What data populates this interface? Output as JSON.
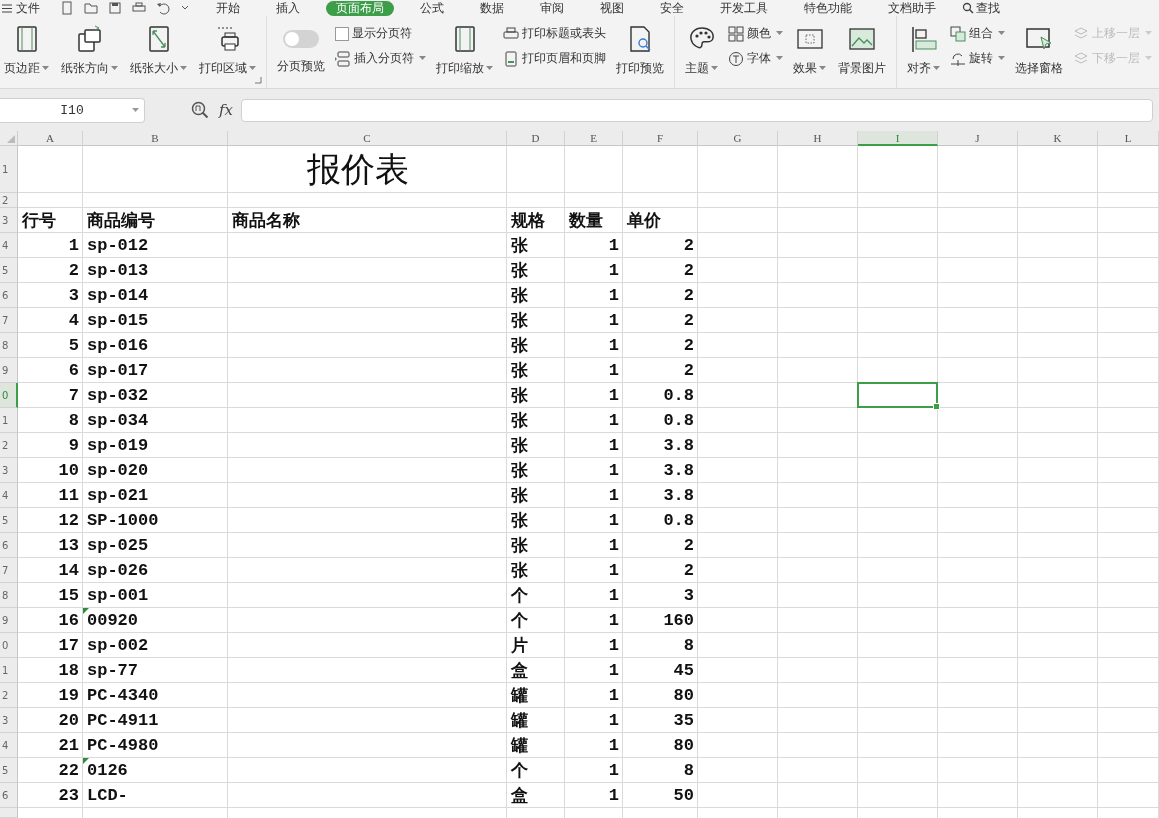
{
  "menu": {
    "file": "文件",
    "tabs": [
      {
        "label": "开始",
        "selected": false
      },
      {
        "label": "插入",
        "selected": false
      },
      {
        "label": "页面布局",
        "selected": true
      },
      {
        "label": "公式",
        "selected": false
      },
      {
        "label": "数据",
        "selected": false
      },
      {
        "label": "审阅",
        "selected": false
      },
      {
        "label": "视图",
        "selected": false
      },
      {
        "label": "安全",
        "selected": false
      },
      {
        "label": "开发工具",
        "selected": false
      },
      {
        "label": "特色功能",
        "selected": false
      },
      {
        "label": "文档助手",
        "selected": false
      }
    ],
    "search": "查找"
  },
  "ribbon": {
    "groups": [
      {
        "launcher": true,
        "items": [
          {
            "kind": "large",
            "label": "页边距",
            "dropdown": true
          },
          {
            "kind": "large",
            "label": "纸张方向",
            "dropdown": true
          },
          {
            "kind": "large",
            "label": "纸张大小",
            "dropdown": true
          },
          {
            "kind": "large",
            "label": "打印区域",
            "dropdown": true
          }
        ]
      },
      {
        "launcher": false,
        "items": [
          {
            "kind": "toggle",
            "label": "分页预览",
            "on": false
          },
          {
            "kind": "stack",
            "buttons": [
              {
                "kind": "checkbox",
                "label": "显示分页符",
                "checked": false,
                "dropdown": false,
                "disabled": false
              },
              {
                "kind": "button",
                "label": "插入分页符",
                "dropdown": true,
                "disabled": false
              }
            ]
          },
          {
            "kind": "large",
            "label": "打印缩放",
            "dropdown": true
          },
          {
            "kind": "stack",
            "buttons": [
              {
                "kind": "button",
                "label": "打印标题或表头",
                "dropdown": false,
                "disabled": false
              },
              {
                "kind": "button",
                "label": "打印页眉和页脚",
                "dropdown": false,
                "disabled": false
              }
            ]
          },
          {
            "kind": "large",
            "label": "打印预览",
            "dropdown": false
          }
        ]
      },
      {
        "launcher": false,
        "items": [
          {
            "kind": "large",
            "label": "主题",
            "dropdown": true
          },
          {
            "kind": "stack",
            "buttons": [
              {
                "kind": "button",
                "label": "颜色",
                "dropdown": true,
                "disabled": false
              },
              {
                "kind": "button",
                "label": "字体",
                "dropdown": true,
                "disabled": false
              }
            ]
          },
          {
            "kind": "large",
            "label": "效果",
            "dropdown": true
          },
          {
            "kind": "large",
            "label": "背景图片",
            "dropdown": false
          }
        ]
      },
      {
        "launcher": false,
        "items": [
          {
            "kind": "large",
            "label": "对齐",
            "dropdown": true
          },
          {
            "kind": "stack",
            "buttons": [
              {
                "kind": "button",
                "label": "组合",
                "dropdown": true,
                "disabled": false
              },
              {
                "kind": "button",
                "label": "旋转",
                "dropdown": true,
                "disabled": false
              }
            ]
          },
          {
            "kind": "large",
            "label": "选择窗格",
            "dropdown": false
          },
          {
            "kind": "stack",
            "buttons": [
              {
                "kind": "button",
                "label": "上移一层",
                "dropdown": true,
                "disabled": true
              },
              {
                "kind": "button",
                "label": "下移一层",
                "dropdown": true,
                "disabled": true
              }
            ]
          }
        ]
      }
    ]
  },
  "formula_bar": {
    "name_box": "I10",
    "fx": "fx"
  },
  "sheet": {
    "columns": [
      {
        "label": "A",
        "selected": false
      },
      {
        "label": "B",
        "selected": false
      },
      {
        "label": "C",
        "selected": false
      },
      {
        "label": "D",
        "selected": false
      },
      {
        "label": "E",
        "selected": false
      },
      {
        "label": "F",
        "selected": false
      },
      {
        "label": "G",
        "selected": false
      },
      {
        "label": "H",
        "selected": false
      },
      {
        "label": "I",
        "selected": true
      },
      {
        "label": "J",
        "selected": false
      },
      {
        "label": "K",
        "selected": false
      },
      {
        "label": "L",
        "selected": false
      }
    ],
    "row_headers": [
      {
        "label": "1",
        "selected": false
      },
      {
        "label": "2",
        "selected": false
      },
      {
        "label": "3",
        "selected": false
      },
      {
        "label": "4",
        "selected": false
      },
      {
        "label": "5",
        "selected": false
      },
      {
        "label": "6",
        "selected": false
      },
      {
        "label": "7",
        "selected": false
      },
      {
        "label": "8",
        "selected": false
      },
      {
        "label": "9",
        "selected": false
      },
      {
        "label": "0",
        "selected": true
      },
      {
        "label": "1",
        "selected": false
      },
      {
        "label": "2",
        "selected": false
      },
      {
        "label": "3",
        "selected": false
      },
      {
        "label": "4",
        "selected": false
      },
      {
        "label": "5",
        "selected": false
      },
      {
        "label": "6",
        "selected": false
      },
      {
        "label": "7",
        "selected": false
      },
      {
        "label": "8",
        "selected": false
      },
      {
        "label": "9",
        "selected": false
      },
      {
        "label": "0",
        "selected": false
      },
      {
        "label": "1",
        "selected": false
      },
      {
        "label": "2",
        "selected": false
      },
      {
        "label": "3",
        "selected": false
      },
      {
        "label": "4",
        "selected": false
      },
      {
        "label": "5",
        "selected": false
      },
      {
        "label": "6",
        "selected": false
      }
    ],
    "title": "报价表",
    "header": [
      "行号",
      "商品编号",
      "商品名称",
      "规格",
      "数量",
      "单价"
    ],
    "rows": [
      {
        "no": "1",
        "code": "sp-012",
        "unit": "张",
        "qty": "1",
        "price": "2",
        "text_flag": false
      },
      {
        "no": "2",
        "code": "sp-013",
        "unit": "张",
        "qty": "1",
        "price": "2",
        "text_flag": false
      },
      {
        "no": "3",
        "code": "sp-014",
        "unit": "张",
        "qty": "1",
        "price": "2",
        "text_flag": false
      },
      {
        "no": "4",
        "code": "sp-015",
        "unit": "张",
        "qty": "1",
        "price": "2",
        "text_flag": false
      },
      {
        "no": "5",
        "code": "sp-016",
        "unit": "张",
        "qty": "1",
        "price": "2",
        "text_flag": false
      },
      {
        "no": "6",
        "code": "sp-017",
        "unit": "张",
        "qty": "1",
        "price": "2",
        "text_flag": false
      },
      {
        "no": "7",
        "code": "sp-032",
        "unit": "张",
        "qty": "1",
        "price": "0.8",
        "text_flag": false
      },
      {
        "no": "8",
        "code": "sp-034",
        "unit": "张",
        "qty": "1",
        "price": "0.8",
        "text_flag": false
      },
      {
        "no": "9",
        "code": "sp-019",
        "unit": "张",
        "qty": "1",
        "price": "3.8",
        "text_flag": false
      },
      {
        "no": "10",
        "code": "sp-020",
        "unit": "张",
        "qty": "1",
        "price": "3.8",
        "text_flag": false
      },
      {
        "no": "11",
        "code": "sp-021",
        "unit": "张",
        "qty": "1",
        "price": "3.8",
        "text_flag": false
      },
      {
        "no": "12",
        "code": "SP-1000",
        "unit": "张",
        "qty": "1",
        "price": "0.8",
        "text_flag": false
      },
      {
        "no": "13",
        "code": "sp-025",
        "unit": "张",
        "qty": "1",
        "price": "2",
        "text_flag": false
      },
      {
        "no": "14",
        "code": "sp-026",
        "unit": "张",
        "qty": "1",
        "price": "2",
        "text_flag": false
      },
      {
        "no": "15",
        "code": "sp-001",
        "unit": "个",
        "qty": "1",
        "price": "3",
        "text_flag": false
      },
      {
        "no": "16",
        "code": "00920",
        "unit": "个",
        "qty": "1",
        "price": "160",
        "text_flag": true
      },
      {
        "no": "17",
        "code": "sp-002",
        "unit": "片",
        "qty": "1",
        "price": "8",
        "text_flag": false
      },
      {
        "no": "18",
        "code": "sp-77",
        "unit": "盒",
        "qty": "1",
        "price": "45",
        "text_flag": false
      },
      {
        "no": "19",
        "code": "PC-4340",
        "unit": "罐",
        "qty": "1",
        "price": "80",
        "text_flag": false
      },
      {
        "no": "20",
        "code": "PC-4911",
        "unit": "罐",
        "qty": "1",
        "price": "35",
        "text_flag": false
      },
      {
        "no": "21",
        "code": "PC-4980",
        "unit": "罐",
        "qty": "1",
        "price": "80",
        "text_flag": false
      },
      {
        "no": "22",
        "code": "0126",
        "unit": "个",
        "qty": "1",
        "price": "8",
        "text_flag": true
      },
      {
        "no": "23",
        "code": "LCD-",
        "unit": "盒",
        "qty": "1",
        "price": "50",
        "text_flag": false
      }
    ]
  }
}
